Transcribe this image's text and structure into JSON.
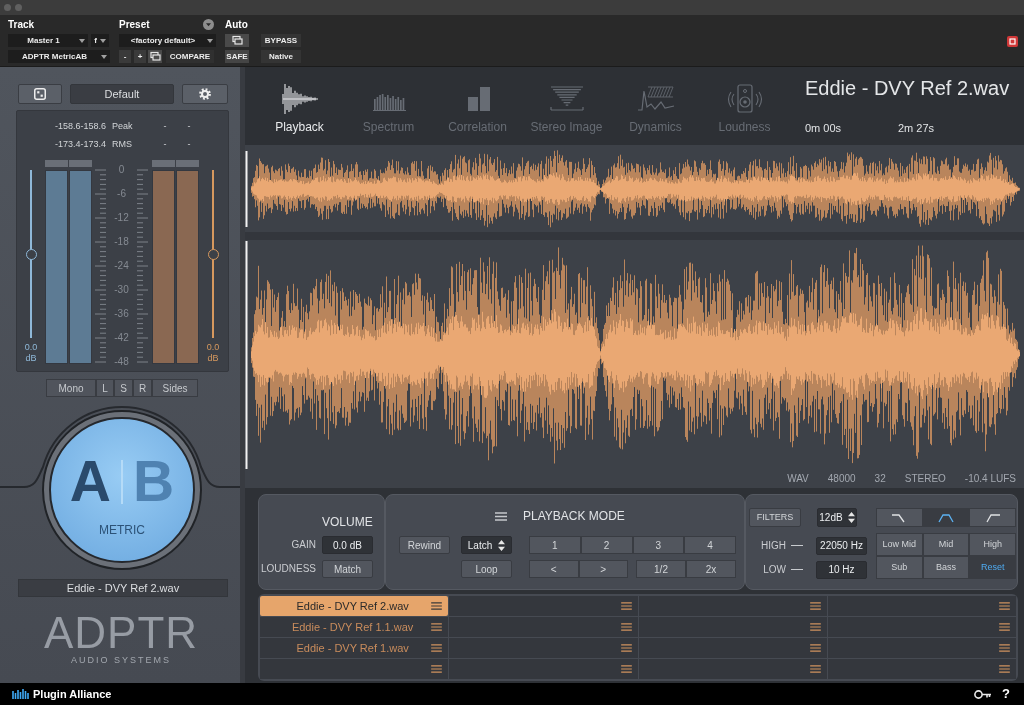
{
  "host_header": {
    "track_label": "Track",
    "preset_label": "Preset",
    "auto_label": "Auto",
    "track_select": "Master 1",
    "channel_select": "f",
    "insert_select": "ADPTR MetricAB",
    "preset_select": "<factory default>",
    "preset_step_buttons": [
      "-",
      "+"
    ],
    "compare_button": "COMPARE",
    "safe_button": "SAFE",
    "bypass_button": "BYPASS",
    "native_button": "Native"
  },
  "left_panel": {
    "preset_field": "Default",
    "readouts": [
      {
        "values": "-158.6-158.6",
        "label": "Peak",
        "b_values": [
          "-",
          "-"
        ]
      },
      {
        "values": "-173.4-173.4",
        "label": "RMS",
        "b_values": [
          "-",
          "-"
        ]
      }
    ],
    "meter_scale": [
      "0",
      "-6",
      "-12",
      "-18",
      "-24",
      "-30",
      "-36",
      "-42",
      "-48"
    ],
    "channels": [
      {
        "level": 0.5,
        "color": "#8fb8d8",
        "value": "0.0",
        "unit": "dB"
      },
      {
        "level": 0.5,
        "color": "#d6985e",
        "value": "0.0",
        "unit": "dB"
      }
    ],
    "monitor_modes": [
      {
        "label": "Mono",
        "selected": false
      },
      {
        "label": "L",
        "selected": false
      },
      {
        "label": "S",
        "selected": false
      },
      {
        "label": "R",
        "selected": false
      },
      {
        "label": "Sides",
        "selected": false
      }
    ],
    "ab_switch": {
      "options": [
        {
          "label": "A",
          "selected": true
        },
        {
          "label": "B",
          "selected": false
        }
      ],
      "caption": "METRIC"
    },
    "file_name": "Eddie - DVY Ref 2.wav",
    "logo": {
      "wordmark": "ADPTR",
      "tagline": "AUDIO SYSTEMS"
    }
  },
  "analyzer_tabs": [
    {
      "label": "Playback",
      "kind": "playback",
      "selected": true
    },
    {
      "label": "Spectrum",
      "kind": "spectrum",
      "selected": false
    },
    {
      "label": "Correlation",
      "kind": "correlation",
      "selected": false
    },
    {
      "label": "Stereo Image",
      "kind": "stereo_image",
      "selected": false
    },
    {
      "label": "Dynamics",
      "kind": "dynamics",
      "selected": false
    },
    {
      "label": "Loudness",
      "kind": "loudness",
      "selected": false
    }
  ],
  "track_info": {
    "title": "Eddie - DVY Ref 2.wav",
    "start_time": "0m 00s",
    "end_time": "2m 27s"
  },
  "waveform_info": [
    "WAV",
    "48000",
    "32",
    "STEREO",
    "-10.4 LUFS"
  ],
  "volume": {
    "title": "VOLUME",
    "gain_label": "GAIN",
    "gain_value": "0.0 dB",
    "loudness_label": "LOUDNESS",
    "match_button": "Match"
  },
  "playback_mode": {
    "title": "PLAYBACK MODE",
    "rewind_button": "Rewind",
    "latch_select": "Latch",
    "loop_button": "Loop",
    "jump_buttons": [
      "1",
      "2",
      "3",
      "4"
    ],
    "step_buttons": [
      "<",
      ">"
    ],
    "speed_buttons": [
      "1/2",
      "2x"
    ]
  },
  "filters": {
    "filters_button": "FILTERS",
    "slope_select": "12dB",
    "shapes": [
      {
        "kind": "lowpass",
        "selected": false
      },
      {
        "kind": "bandpass",
        "selected": true
      },
      {
        "kind": "highpass",
        "selected": false
      }
    ],
    "high": {
      "label": "HIGH",
      "value": "22050 Hz"
    },
    "low": {
      "label": "LOW",
      "value": "10 Hz"
    },
    "bands": [
      {
        "label": "Low Mid",
        "selected": false
      },
      {
        "label": "Mid",
        "selected": false
      },
      {
        "label": "High",
        "selected": false
      },
      {
        "label": "Sub",
        "selected": false
      },
      {
        "label": "Bass",
        "selected": false
      },
      {
        "label": "Reset",
        "selected": true
      }
    ]
  },
  "file_slots": [
    [
      {
        "name": "Eddie - DVY Ref 2.wav",
        "selected": true
      },
      {
        "selected": false
      },
      {
        "selected": false
      },
      {
        "selected": false
      }
    ],
    [
      {
        "name": "Eddie - DVY Ref 1.1.wav",
        "selected": false
      },
      {
        "selected": false
      },
      {
        "selected": false
      },
      {
        "selected": false
      }
    ],
    [
      {
        "name": "Eddie - DVY Ref 1.wav",
        "selected": false
      },
      {
        "selected": false
      },
      {
        "selected": false
      },
      {
        "selected": false
      }
    ],
    [
      {
        "selected": false
      },
      {
        "selected": false
      },
      {
        "selected": false
      },
      {
        "selected": false
      }
    ]
  ],
  "footer": {
    "brand": "Plugin Alliance",
    "help": "?"
  }
}
